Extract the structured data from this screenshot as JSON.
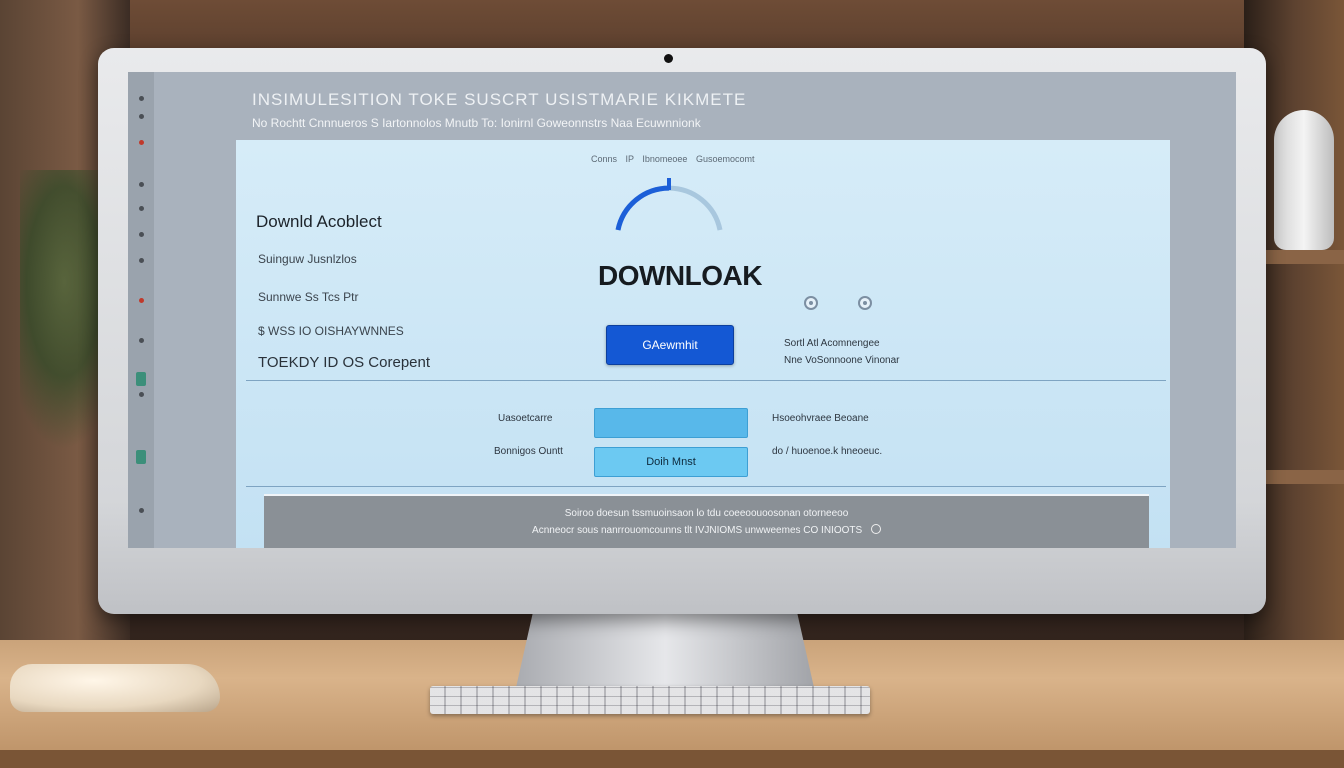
{
  "window": {
    "title": "INSIMULESITION TOKE SUSCRT USISTMARIE KIKMETE",
    "subtitle": "No Rochtt Cnnnueros S Iartonnolos Mnutb To: Ionirnl Goweonnstrs Naa Ecuwnnionk"
  },
  "panel": {
    "top_links": [
      "Conns IP",
      "Ibnomeoee",
      "Gusoemocomt"
    ],
    "left": {
      "heading": "Downld Acoblect",
      "rows": [
        "Suinguw Jusnlzlos",
        "Sunnwe Ss Tcs Ptr",
        "$ WSS IO OISHAYWNNES",
        "TOEKDY ID OS Corepent"
      ]
    },
    "download": {
      "title": "DOWNLOAK",
      "progress": 0.5,
      "primary_button": "GAewmhit"
    },
    "side_note": [
      "Sortl Atl Acomnengee",
      "Nne VoSonnoone Vinonar"
    ],
    "form": {
      "label_1": "Uasoetcarre",
      "label_2": "Bonnigos Ountt",
      "field_button": "Doih Mnst",
      "hint_1": "Hsoeohvraee Beoane",
      "hint_2": "do / huoenoe.k hneoeuc."
    },
    "footer": {
      "line_1": "Soiroo doesun tssmuoinsaon lo tdu coeeoouoosonan otorneeoo",
      "line_2": "Acnneocr sous nanrrouomcounns tlt IVJNIOMS unwweemes CO INIOOTS"
    }
  },
  "colors": {
    "accent": "#1458d4",
    "field": "#58b8ea",
    "panel": "#d6ecf8"
  }
}
